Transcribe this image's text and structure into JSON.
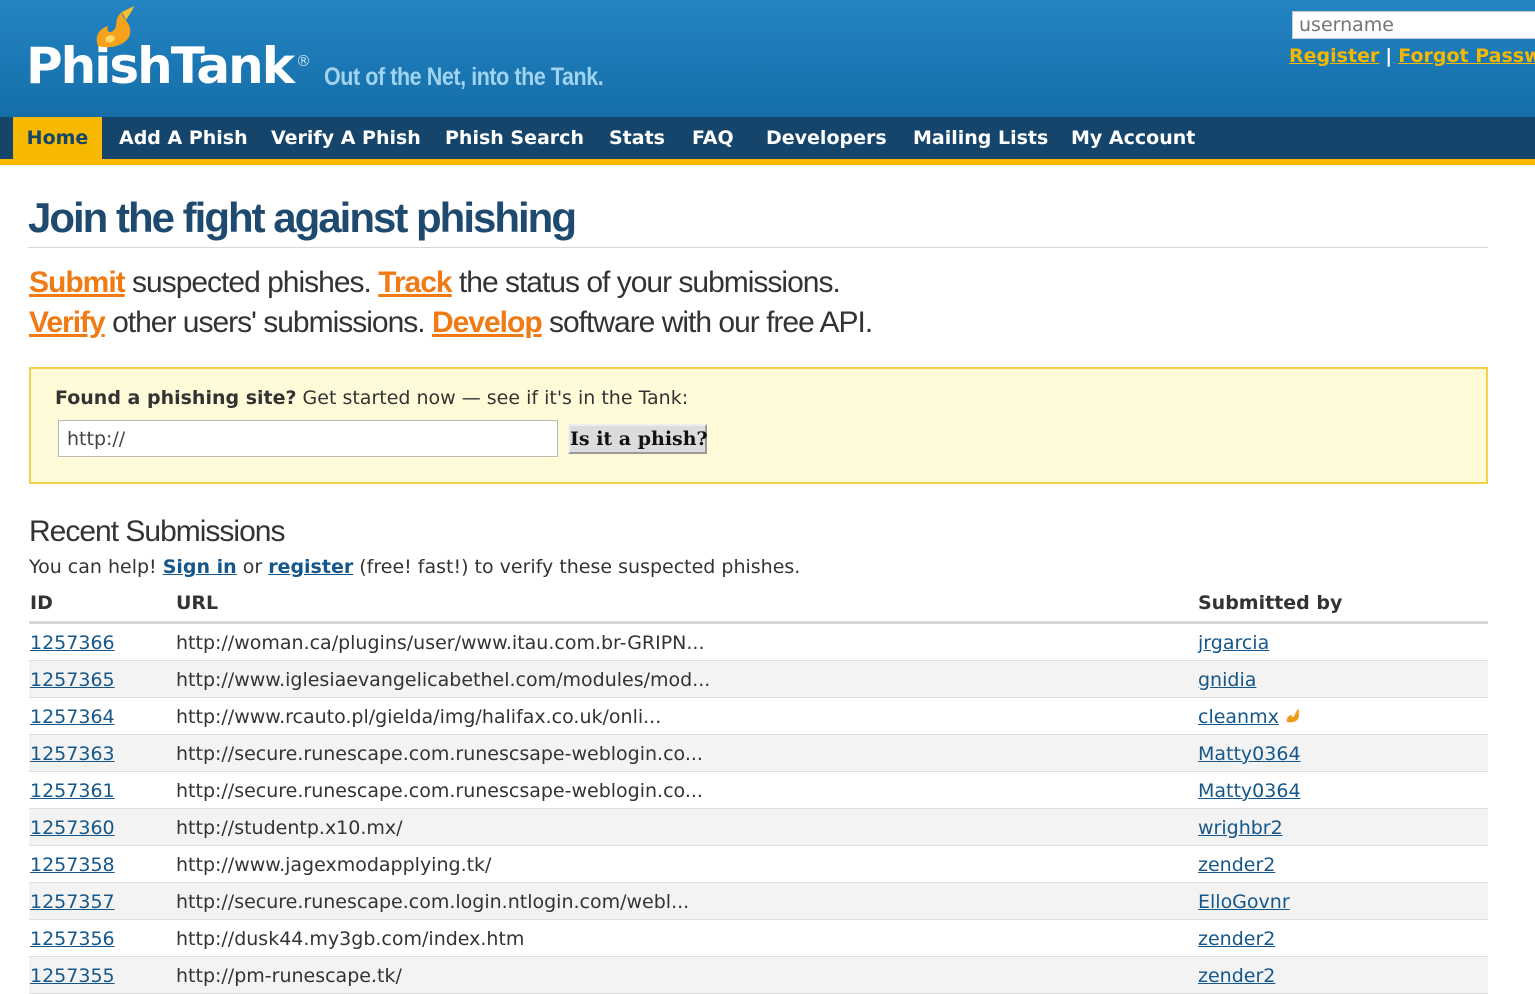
{
  "header": {
    "logo_text": "PhishTank",
    "logo_reg": "®",
    "tagline": "Out of the Net, into the Tank.",
    "login": {
      "username_placeholder": "username",
      "register_label": "Register",
      "separator": "|",
      "forgot_label": "Forgot Passw"
    }
  },
  "nav": {
    "items": [
      {
        "label": "Home",
        "active": true
      },
      {
        "label": "Add A Phish"
      },
      {
        "label": "Verify A Phish"
      },
      {
        "label": "Phish Search"
      },
      {
        "label": "Stats"
      },
      {
        "label": "FAQ"
      },
      {
        "label": "Developers"
      },
      {
        "label": "Mailing Lists"
      },
      {
        "label": "My Account"
      }
    ]
  },
  "main": {
    "title": "Join the fight against phishing",
    "promo": {
      "submit": "Submit",
      "submit_rest": " suspected phishes. ",
      "track": "Track",
      "track_rest": " the status of your submissions.",
      "verify": "Verify",
      "verify_rest": " other users' submissions. ",
      "develop": "Develop",
      "develop_rest": " software with our free API."
    },
    "check": {
      "prompt_bold": "Found a phishing site?",
      "prompt_rest": " Get started now — see if it's in the Tank:",
      "url_value": "http://",
      "button_label": "Is it a phish?"
    },
    "recent": {
      "title": "Recent Submissions",
      "help_prefix": "You can help! ",
      "signin_label": "Sign in",
      "help_or": " or ",
      "register_label": "register",
      "help_suffix": " (free! fast!) to verify these suspected phishes.",
      "columns": {
        "id": "ID",
        "url": "URL",
        "submitted_by": "Submitted by"
      },
      "rows": [
        {
          "id": "1257366",
          "url": "http://woman.ca/plugins/user/www.itau.com.br-GRIPN...",
          "user": "jrgarcia"
        },
        {
          "id": "1257365",
          "url": "http://www.iglesiaevangelicabethel.com/modules/mod...",
          "user": "gnidia"
        },
        {
          "id": "1257364",
          "url": "http://www.rcauto.pl/gielda/img/halifax.co.uk/onli...",
          "user": "cleanmx",
          "flame": true
        },
        {
          "id": "1257363",
          "url": "http://secure.runescape.com.runescsape-weblogin.co...",
          "user": "Matty0364"
        },
        {
          "id": "1257361",
          "url": "http://secure.runescape.com.runescsape-weblogin.co...",
          "user": "Matty0364"
        },
        {
          "id": "1257360",
          "url": "http://studentp.x10.mx/",
          "user": "wrighbr2"
        },
        {
          "id": "1257358",
          "url": "http://www.jagexmodapplying.tk/",
          "user": "zender2"
        },
        {
          "id": "1257357",
          "url": "http://secure.runescape.com.login.ntlogin.com/webl...",
          "user": "ElloGovnr"
        },
        {
          "id": "1257356",
          "url": "http://dusk44.my3gb.com/index.htm",
          "user": "zender2"
        },
        {
          "id": "1257355",
          "url": "http://pm-runescape.tk/",
          "user": "zender2"
        }
      ]
    }
  },
  "colors": {
    "header_blue": "#1a7ab8",
    "nav_navy": "#16456b",
    "accent_yellow": "#f6b900",
    "link_orange": "#f07a14",
    "link_blue": "#15578a"
  }
}
